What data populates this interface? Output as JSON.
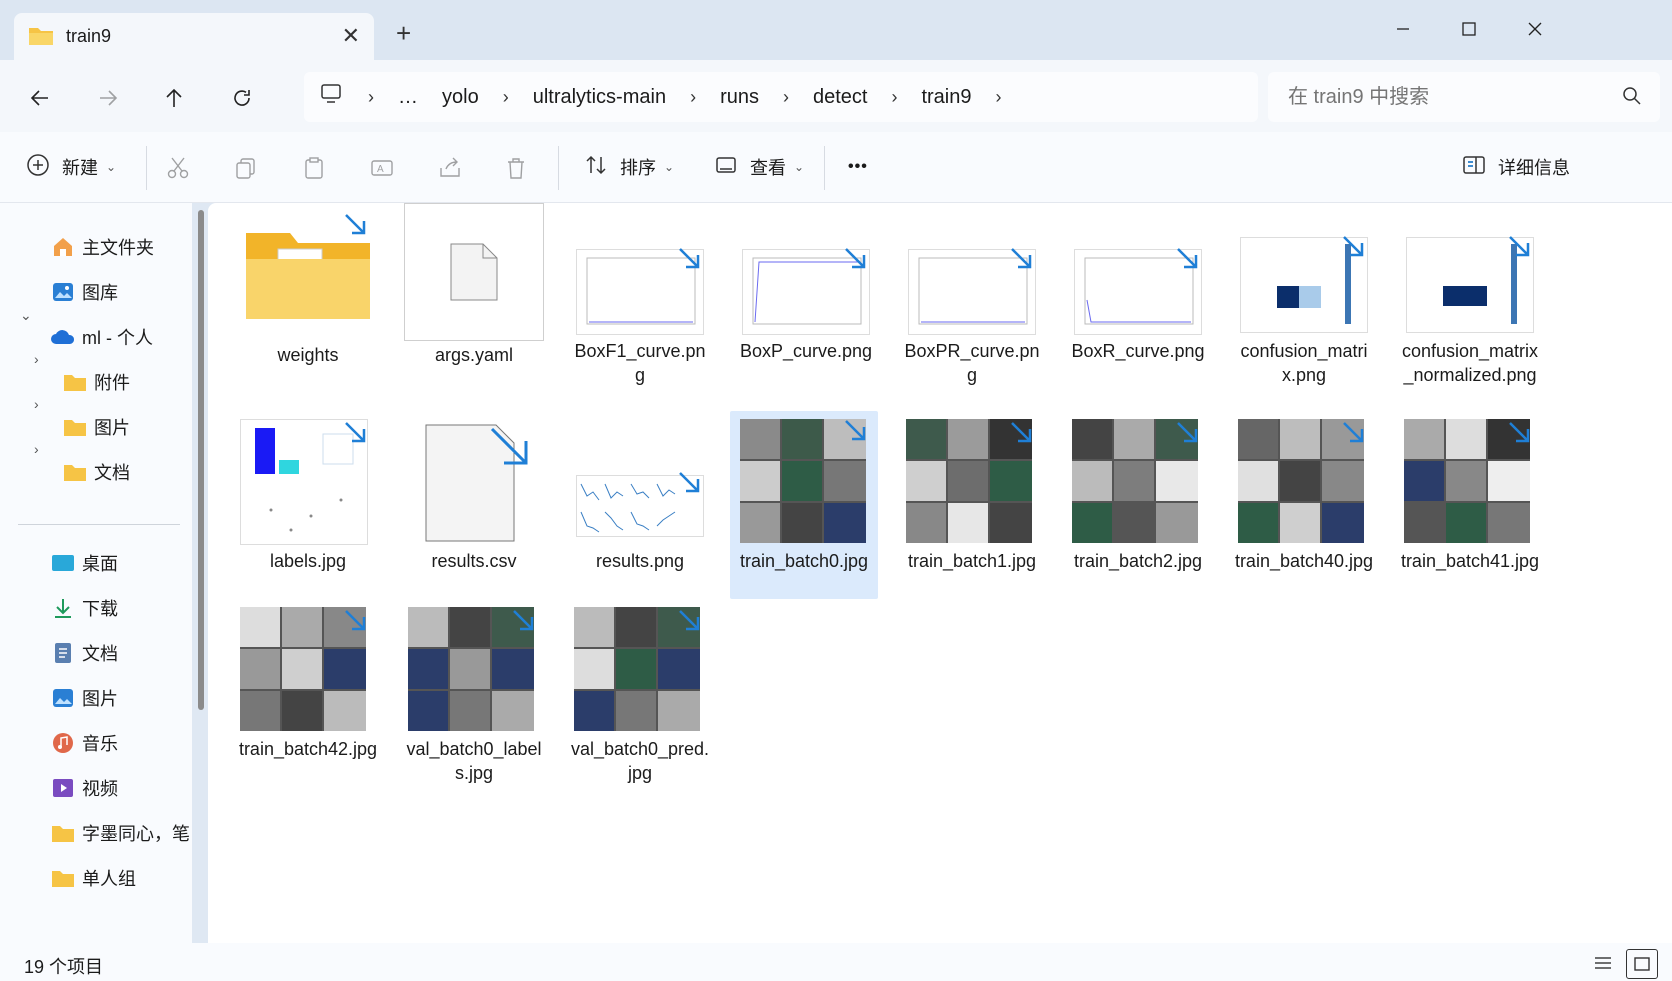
{
  "window": {
    "tab_title": "train9",
    "tab_close_icon": "close-icon",
    "new_tab_icon": "plus-icon",
    "minimize_icon": "minimize-icon",
    "maximize_icon": "maximize-icon",
    "close_icon": "close-icon"
  },
  "address": {
    "breadcrumbs": [
      "…",
      "yolo",
      "ultralytics-main",
      "runs",
      "detect",
      "train9"
    ],
    "search_placeholder": "在 train9 中搜索"
  },
  "toolbar": {
    "new_label": "新建",
    "sort_label": "排序",
    "view_label": "查看",
    "more_label": "•••",
    "details_label": "详细信息"
  },
  "sidebar": {
    "items": [
      {
        "label": "主文件夹",
        "icon": "home-icon"
      },
      {
        "label": "图库",
        "icon": "gallery-icon"
      },
      {
        "label": "ml - 个人",
        "icon": "cloud-icon"
      },
      {
        "label": "附件",
        "icon": "folder-icon"
      },
      {
        "label": "图片",
        "icon": "folder-icon"
      },
      {
        "label": "文档",
        "icon": "folder-icon"
      },
      {
        "label": "桌面",
        "icon": "desktop-icon"
      },
      {
        "label": "下载",
        "icon": "download-icon"
      },
      {
        "label": "文档",
        "icon": "documents-icon"
      },
      {
        "label": "图片",
        "icon": "pictures-icon"
      },
      {
        "label": "音乐",
        "icon": "music-icon"
      },
      {
        "label": "视频",
        "icon": "video-icon"
      },
      {
        "label": "字墨同心，笔",
        "icon": "folder-icon"
      },
      {
        "label": "单人组",
        "icon": "folder-icon"
      }
    ]
  },
  "files": [
    {
      "name": "weights",
      "kind": "folder"
    },
    {
      "name": "args.yaml",
      "kind": "doc"
    },
    {
      "name": "BoxF1_curve.png",
      "kind": "chart"
    },
    {
      "name": "BoxP_curve.png",
      "kind": "chart"
    },
    {
      "name": "BoxPR_curve.png",
      "kind": "chart"
    },
    {
      "name": "BoxR_curve.png",
      "kind": "chart"
    },
    {
      "name": "confusion_matrix.png",
      "kind": "matrix"
    },
    {
      "name": "confusion_matrix_normalized.png",
      "kind": "matrix"
    },
    {
      "name": "labels.jpg",
      "kind": "labels"
    },
    {
      "name": "results.csv",
      "kind": "doc"
    },
    {
      "name": "results.png",
      "kind": "results"
    },
    {
      "name": "train_batch0.jpg",
      "kind": "photo"
    },
    {
      "name": "train_batch1.jpg",
      "kind": "photo"
    },
    {
      "name": "train_batch2.jpg",
      "kind": "photo"
    },
    {
      "name": "train_batch40.jpg",
      "kind": "photo"
    },
    {
      "name": "train_batch41.jpg",
      "kind": "photo"
    },
    {
      "name": "train_batch42.jpg",
      "kind": "photo"
    },
    {
      "name": "val_batch0_labels.jpg",
      "kind": "photo"
    },
    {
      "name": "val_batch0_pred.jpg",
      "kind": "photo"
    }
  ],
  "status": {
    "item_count": "19 个项目"
  },
  "colors": {
    "accent": "#0067c0",
    "selected_bg": "#dbeafc",
    "folder_yellow": "#f6c445",
    "sync_arrow": "#1f7fd6"
  }
}
